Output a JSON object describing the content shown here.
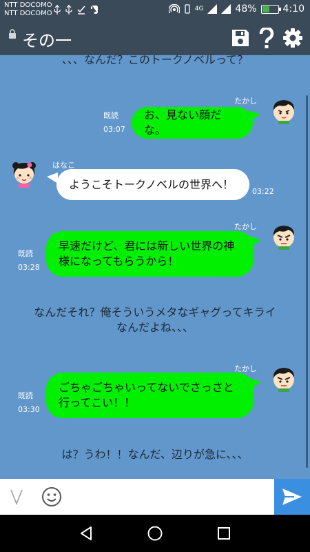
{
  "status_bar": {
    "carrier_line1": "NTT DOCOMO",
    "carrier_line2": "NTT DOCOMO",
    "signal_label": "4G",
    "battery_percent": "48%",
    "battery_level": 0.48,
    "time": "4:10"
  },
  "app_bar": {
    "title": "その一"
  },
  "chat": {
    "narration_top": "、、、なんだ？このトークノベルって？",
    "msg1": {
      "name": "たかし",
      "text": "お、見ない顔だな。",
      "read": "既読",
      "time": "03:07"
    },
    "msg2": {
      "name": "はなこ",
      "text": "ようこそトークノベルの世界へ！",
      "time": "03:22"
    },
    "msg3": {
      "name": "たかし",
      "line1": "早速だけど、君には新しい世界の神",
      "line2": "様になってもらうから！",
      "read": "既読",
      "time": "03:28"
    },
    "narration_mid_line1": "なんだそれ？俺そういうメタなギャグってキライ",
    "narration_mid_line2": "なんだよね、、、",
    "msg4": {
      "name": "たかし",
      "line1": "ごちゃごちゃいってないでさっさと",
      "line2": "行ってこい！！",
      "read": "既読",
      "time": "03:30"
    },
    "narration_bottom": "は？うわ！！なんだ、辺りが急に、、、"
  },
  "input": {
    "value": "",
    "placeholder": ""
  },
  "colors": {
    "chat_bg": "#6297cc",
    "header_bg": "#3a4a59",
    "bubble_green": "#00f000",
    "send_blue": "#3b8fe0"
  }
}
